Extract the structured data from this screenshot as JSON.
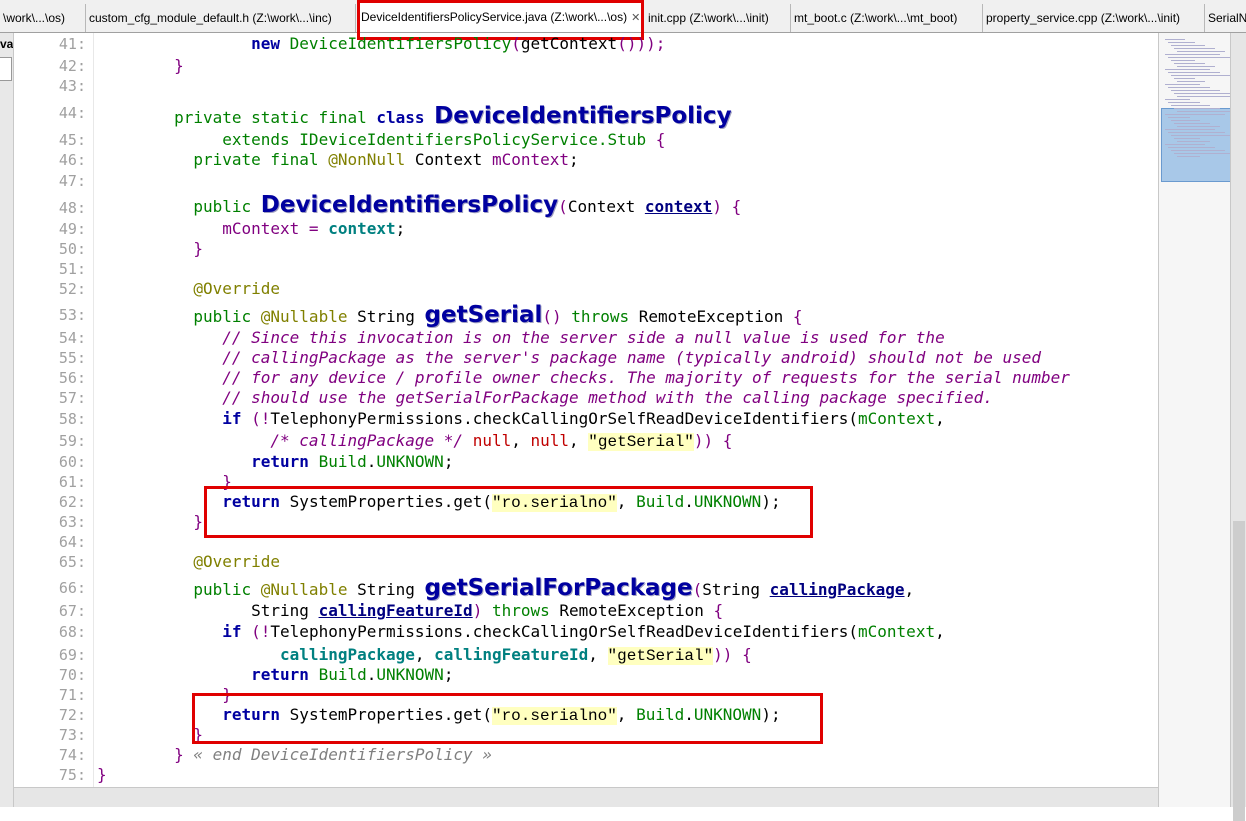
{
  "tabs": [
    {
      "label": "\\work\\...\\os)"
    },
    {
      "label": "custom_cfg_module_default.h (Z:\\work\\...\\inc)"
    },
    {
      "label": "DeviceIdentifiersPolicyService.java (Z:\\work\\...\\os)",
      "close": "✕"
    },
    {
      "label": "init.cpp (Z:\\work\\...\\init)"
    },
    {
      "label": "mt_boot.c (Z:\\work\\...\\mt_boot)"
    },
    {
      "label": "property_service.cpp (Z:\\work\\...\\init)"
    },
    {
      "label": "SerialN"
    }
  ],
  "left_strip_label": "va",
  "line_numbers": [
    "41:",
    "42:",
    "43:",
    "44:",
    "45:",
    "46:",
    "47:",
    "48:",
    "49:",
    "50:",
    "51:",
    "52:",
    "53:",
    "54:",
    "55:",
    "56:",
    "57:",
    "58:",
    "59:",
    "60:",
    "61:",
    "62:",
    "63:",
    "64:",
    "65:",
    "66:",
    "67:",
    "68:",
    "69:",
    "70:",
    "71:",
    "72:",
    "73:",
    "74:",
    "75:"
  ],
  "code": {
    "l41": {
      "a": "new ",
      "b": "DeviceIdentifiersPolicy",
      "c": "(",
      "d": "getContext",
      "e": "()));"
    },
    "l42": "}",
    "l44": {
      "a": "private static final ",
      "b": "class ",
      "c": "DeviceIdentifiersPolicy"
    },
    "l45": {
      "a": "extends ",
      "b": "IDeviceIdentifiersPolicyService.Stub",
      "c": " {"
    },
    "l46": {
      "a": "private final ",
      "b": "@NonNull",
      "c": " Context ",
      "d": "mContext",
      "e": ";"
    },
    "l48": {
      "a": "public ",
      "b": "DeviceIdentifiersPolicy",
      "c": "(",
      "d": "Context ",
      "e": "context",
      "f": ") {"
    },
    "l49": {
      "a": "mContext",
      "b": " = ",
      "c": "context",
      "d": ";"
    },
    "l50": "}",
    "l52": "@Override",
    "l53": {
      "a": "public ",
      "b": "@Nullable",
      "c": " String ",
      "d": "getSerial",
      "e": "() ",
      "f": "throws",
      "g": " RemoteException ",
      "h": "{"
    },
    "l54": "// Since this invocation is on the server side a null value is used for the",
    "l55": "// callingPackage as the server's package name (typically android) should not be used",
    "l56": "// for any device / profile owner checks. The majority of requests for the serial number",
    "l57": "// should use the getSerialForPackage method with the calling package specified.",
    "l58": {
      "a": "if",
      "b": " (!",
      "c": "TelephonyPermissions",
      "d": ".checkCallingOrSelfReadDeviceIdentifiers(",
      "e": "mContext",
      "f": ","
    },
    "l59": {
      "a": "/* callingPackage */ ",
      "b": "null",
      "c": ", ",
      "d": "null",
      "e": ", ",
      "f": "\"getSerial\"",
      "g": ")) {"
    },
    "l60": {
      "a": "return ",
      "b": "Build",
      "c": ".",
      "d": "UNKNOWN",
      "e": ";"
    },
    "l61": "}",
    "l62": {
      "a": "return ",
      "b": "SystemProperties.get(",
      "c": "\"ro.serialno\"",
      "d": ", ",
      "e": "Build",
      "f": ".",
      "g": "UNKNOWN",
      "h": ");"
    },
    "l63": "}",
    "l65": "@Override",
    "l66": {
      "a": "public ",
      "b": "@Nullable",
      "c": " String ",
      "d": "getSerialForPackage",
      "e": "(",
      "f": "String ",
      "g": "callingPackage",
      "h": ","
    },
    "l67": {
      "a": "String ",
      "b": "callingFeatureId",
      "c": ") ",
      "d": "throws",
      "e": " RemoteException ",
      "f": "{"
    },
    "l68": {
      "a": "if",
      "b": " (!",
      "c": "TelephonyPermissions",
      "d": ".checkCallingOrSelfReadDeviceIdentifiers(",
      "e": "mContext",
      "f": ","
    },
    "l69": {
      "a": "callingPackage",
      "b": ", ",
      "c": "callingFeatureId",
      "d": ", ",
      "e": "\"getSerial\"",
      "f": ")) {"
    },
    "l70": {
      "a": "return ",
      "b": "Build",
      "c": ".",
      "d": "UNKNOWN",
      "e": ";"
    },
    "l71": "}",
    "l72": {
      "a": "return ",
      "b": "SystemProperties.get(",
      "c": "\"ro.serialno\"",
      "d": ", ",
      "e": "Build",
      "f": ".",
      "g": "UNKNOWN",
      "h": ");"
    },
    "l73": "}",
    "l74": {
      "a": "} ",
      "b": "« end DeviceIdentifiersPolicy »"
    },
    "l75": "}"
  },
  "colors": {
    "highlight_box": "#e00000",
    "keyword": "#0000a0",
    "comment": "#800080"
  }
}
